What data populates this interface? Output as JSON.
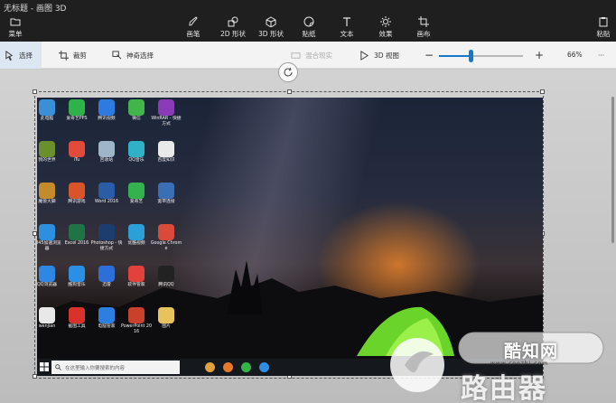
{
  "window": {
    "title": "无标题 - 画图 3D"
  },
  "ribbon": {
    "menu_label": "菜单",
    "tools": [
      "画笔",
      "2D 形状",
      "3D 形状",
      "贴纸",
      "文本",
      "效果",
      "画布"
    ],
    "paste_label": "粘贴"
  },
  "toolbar": {
    "select_label": "选择",
    "crop_label": "裁剪",
    "magic_select_label": "神奇选择",
    "mixed_reality_label": "混合现实",
    "view_3d_label": "3D 视图",
    "zoom_value": "66%",
    "zoom_fraction": 0.38,
    "more_label": "···"
  },
  "desktop": {
    "icons": [
      {
        "label": "此电脑",
        "color": "#3a8fd6"
      },
      {
        "label": "爱奇艺PPS",
        "color": "#2fb24a"
      },
      {
        "label": "腾讯视频",
        "color": "#2d7be0"
      },
      {
        "label": "微信",
        "color": "#3fb54a"
      },
      {
        "label": "WinRAR - 快捷方式",
        "color": "#8c3bb8"
      },
      {
        "label": "我的世界",
        "color": "#6a8f2c"
      },
      {
        "label": "iTu",
        "color": "#e04b3a"
      },
      {
        "label": "回收站",
        "color": "#9fb6c9"
      },
      {
        "label": "QQ音乐",
        "color": "#2fb2c8"
      },
      {
        "label": "百度知识",
        "color": "#e9e9e9"
      },
      {
        "label": "魔兽大脚",
        "color": "#c48b2b"
      },
      {
        "label": "腾讯游戏",
        "color": "#d8552c"
      },
      {
        "label": "Word 2016",
        "color": "#2b5ca8"
      },
      {
        "label": "爱奇艺",
        "color": "#33b34c"
      },
      {
        "label": "宽带连接",
        "color": "#3a6fb5"
      },
      {
        "label": "2345加速浏览器",
        "color": "#2d8fe0"
      },
      {
        "label": "Excel 2016",
        "color": "#217346"
      },
      {
        "label": "Photoshop - 快捷方式",
        "color": "#1c3d6e"
      },
      {
        "label": "优酷视频",
        "color": "#2a9fd8"
      },
      {
        "label": "Google Chrome",
        "color": "#d94a3a"
      },
      {
        "label": "QQ浏览器",
        "color": "#2d87e3"
      },
      {
        "label": "酷狗音乐",
        "color": "#2b8fe6"
      },
      {
        "label": "迅雷",
        "color": "#2c6fd8"
      },
      {
        "label": "软件管家",
        "color": "#e2423b"
      },
      {
        "label": "腾讯QQ",
        "color": "#222222"
      },
      {
        "label": "wenjian",
        "color": "#e8e8e8"
      },
      {
        "label": "截图工具",
        "color": "#d8322b"
      },
      {
        "label": "电脑管家",
        "color": "#2b7fe0"
      },
      {
        "label": "PowerPoint 2016",
        "color": "#c9412b"
      },
      {
        "label": "图片",
        "color": "#e8c25a"
      }
    ],
    "taskbar": {
      "search_placeholder": "在这里输入你要搜索的内容",
      "task_icons": [
        "#e0a23a",
        "#e8792b",
        "#35b44a",
        "#2f8fe3"
      ]
    }
  },
  "watermark": {
    "brand": "酷知网",
    "site": "www.coozhi.com",
    "overlay": "路由器"
  }
}
